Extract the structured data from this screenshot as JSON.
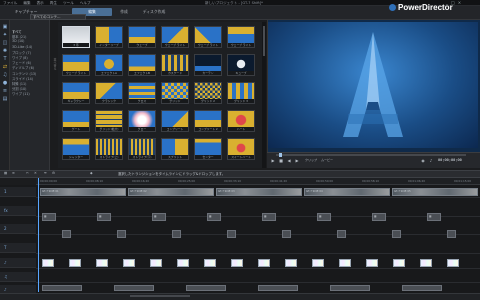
{
  "window": {
    "menus": [
      "ファイル",
      "編集",
      "表示",
      "再生",
      "ツール",
      "ヘルプ"
    ],
    "title": "新しいプロジェクト - [GT-7 Shift]*",
    "controls": [
      "_",
      "□",
      "×"
    ],
    "brand": "PowerDirector"
  },
  "modes": [
    "キャプチャー",
    "編集",
    "作成",
    "ディスク作成"
  ],
  "library": {
    "dropdown": "すべてのコンテ...",
    "categories": [
      "すべて",
      "基本 (21)",
      "3D (10)",
      "3D-Like (14)",
      "ブロック (7)",
      "ワイプ (8)",
      "フェード (6)",
      "ディゾルブ (6)",
      "コンテンツ (13)",
      "スライド (14)",
      "特殊 (11)",
      "分割 (10)",
      "ワイプ (11)"
    ],
    "sort_label": "並べ替え",
    "tiles": [
      [
        "3 帯",
        "インターリーブ",
        "ウェーブ",
        "ウェーブ ライト",
        "ウェーブ ライト",
        "ウェーブ ライト"
      ],
      [
        "ウェーブ ライト",
        "エフェクトA",
        "エフェクトB",
        "カスケード",
        "カーテン",
        "キューブ"
      ],
      [
        "ギャラクシー",
        "クラシック",
        "クロス",
        "グリッド",
        "グリッド 2",
        "グリッド 3"
      ],
      [
        "ゲート",
        "グリッド(拡大)",
        "グロー",
        "コンプリート",
        "コンプリート 2",
        "ハート"
      ],
      [
        "シャッター",
        "ストライプ(上)",
        "ストライプ(下)",
        "スプリット",
        "センター",
        "スイートハート"
      ]
    ]
  },
  "preview": {
    "timecode": "00;00;00;00",
    "mode_clip": "クリップ",
    "mode_movie": "ムービー"
  },
  "timeline": {
    "hint": "選択したトランジションをタイムラインにドラッグ&ドロップします。",
    "ruler": [
      "00;00;00;00",
      "00;00;08;10",
      "00;00;16;20",
      "00;00;25;00",
      "00;00;33;10",
      "00;00;41;20",
      "00;00;50;00",
      "00;00;58;10",
      "00;01;06;20",
      "00;01;15;00"
    ],
    "video_clips": [
      "GT-7 Shift 01",
      "GT-7 Shift 02",
      "GT-7 Shift 03",
      "GT-7 Shift 04",
      "GT-7 Shift 05"
    ],
    "transition_labels": [
      "トランジション",
      "トランジション",
      "トランジション",
      "トランジション",
      "トランジション",
      "トランジション",
      "トランジション",
      "トランジション"
    ],
    "track_names": [
      "1",
      "fx",
      "2",
      "T",
      "♪",
      "♫",
      "♪"
    ]
  },
  "colors": {
    "accent": "#4a6f96",
    "tile_blue": "#2a72c7",
    "tile_gold": "#d9b030",
    "preview_blue": "#3a86cf",
    "playhead": "#58a6ff"
  }
}
